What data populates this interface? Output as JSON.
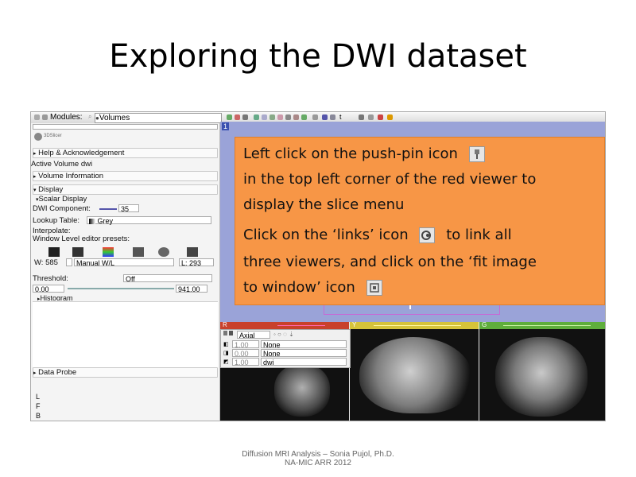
{
  "title": "Exploring the DWI dataset",
  "toolbar": {
    "modules_label": "Modules:",
    "module_value": "Volumes",
    "viewer_number": "1",
    "layout_t": "t"
  },
  "left_panel": {
    "logo_text": "3DSlicer",
    "help_section": "Help & Acknowledgement",
    "active_volume_label": "Active Volume",
    "active_volume_value": "dwi",
    "volume_info_section": "Volume Information",
    "display_section": "Display",
    "scalar_display_section": "Scalar Display",
    "dwi_component_label": "DWI Component:",
    "dwi_component_value": "35",
    "lookup_table_label": "Lookup Table:",
    "lookup_table_value": "Grey",
    "interpolate_label": "Interpolate:",
    "wl_presets_label": "Window Level editor presets:",
    "w_label": "W: 585",
    "wl_mode": "Manual W/L",
    "l_label": "L: 293",
    "threshold_label": "Threshold:",
    "threshold_value": "Off",
    "range_min": "0.00",
    "range_max": "941.00",
    "histogram_section": "Histogram",
    "data_probe_section": "Data Probe",
    "probe_letters": [
      "L",
      "F",
      "B"
    ]
  },
  "slice_menu": {
    "orientation": "Axial",
    "rows": [
      {
        "opacity": "1.00",
        "value": "None"
      },
      {
        "opacity": "0.00",
        "value": "None"
      },
      {
        "opacity": "1.00",
        "value": "dwi"
      }
    ]
  },
  "viewers": {
    "red": {
      "label": "R",
      "color": "#c8412c"
    },
    "yellow": {
      "label": "Y",
      "color": "#d6c33a"
    },
    "green": {
      "label": "G",
      "color": "#5fae3c"
    }
  },
  "callout": {
    "line1": "Left click on the push-pin icon",
    "line2": "in the top left corner of the red viewer to",
    "line3": "display the slice menu",
    "line4a": "Click on the ‘links’ icon",
    "line4b": "to link all",
    "line5": "three viewers, and click on the ‘fit image",
    "line6": "to window’ icon",
    "pin_icon": "push-pin-icon",
    "link_icon": "links-icon",
    "fit_icon": "fit-to-window-icon"
  },
  "footer": {
    "line1": "Diffusion MRI Analysis – Sonia Pujol, Ph.D.",
    "line2": "NA-MIC ARR 2012"
  }
}
